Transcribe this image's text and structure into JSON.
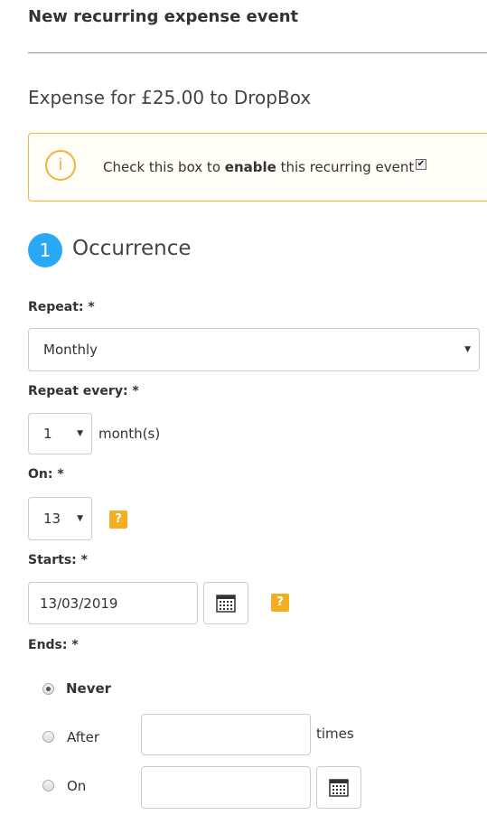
{
  "header": {
    "title": "New recurring expense event"
  },
  "subtitle": "Expense for £25.00 to DropBox",
  "notice": {
    "icon": "info-icon",
    "icon_glyph": "i",
    "text_before": "Check this box to ",
    "text_bold": "enable",
    "text_after": " this recurring event",
    "checked": true,
    "check_glyph": "✔",
    "accent": "#f0b43c"
  },
  "step": {
    "number": "1",
    "title": "Occurrence",
    "color": "#29a8f5"
  },
  "repeat": {
    "label": "Repeat: *",
    "value": "Monthly",
    "arrow": "▼"
  },
  "repeat_every": {
    "label": "Repeat every: *",
    "value": "1",
    "unit": "month(s)",
    "arrow": "▼"
  },
  "on": {
    "label": "On: *",
    "value": "13",
    "arrow": "▼",
    "help": "?"
  },
  "starts": {
    "label": "Starts: *",
    "value": "13/03/2019",
    "help": "?"
  },
  "ends": {
    "label": "Ends: *",
    "options": [
      {
        "label": "Never",
        "selected": true
      },
      {
        "label": "After",
        "selected": false,
        "suffix": "times"
      },
      {
        "label": "On",
        "selected": false
      }
    ]
  },
  "colors": {
    "help": "#f5ad22",
    "border": "#cccccc"
  }
}
